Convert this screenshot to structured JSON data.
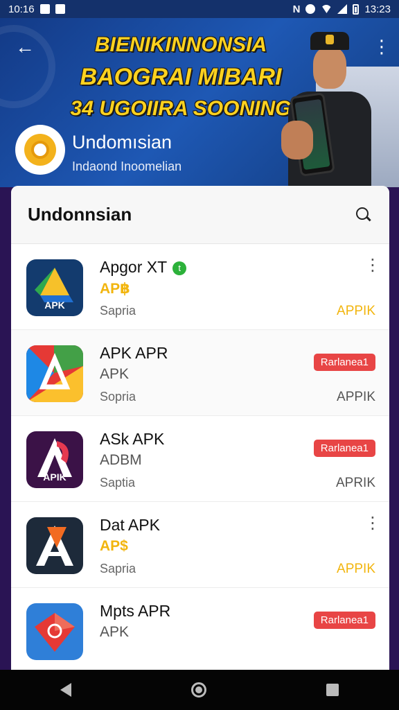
{
  "status_bar": {
    "time": "10:16",
    "clock_right": "13:23"
  },
  "banner": {
    "headline_line1": "BIENIKINNONSIA",
    "headline_line2": "BAOGRAI MIBARI",
    "headline_line3": "34 UGOIIRA SOONING",
    "app_name": "Undomısian",
    "app_subtitle": "Indaond Inoomelian"
  },
  "card": {
    "title": "Undonnsian",
    "apps": [
      {
        "name": "Apgor XT",
        "verified_mark": "t",
        "sub": "AP฿",
        "meta": "Sapria",
        "right": "APPIK"
      },
      {
        "name": "APK APR",
        "sub": "APK",
        "meta": "Sopria",
        "right": "APPIK",
        "badge": "Rarlanea1"
      },
      {
        "name": "ASk APK",
        "sub": "ADBM",
        "meta": "Saptia",
        "right": "APRIK",
        "badge": "Rarlanea1"
      },
      {
        "name": "Dat APK",
        "sub": "AP$",
        "meta": "Sapria",
        "right": "APPIK"
      },
      {
        "name": "Mpts APR",
        "sub": "APK",
        "badge": "Rarlanea1"
      }
    ],
    "icon_labels": {
      "app0": "APK",
      "app2": "APIK"
    }
  },
  "colors": {
    "banner_bg": "#1a4a9e",
    "accent_gold": "#f2b50e",
    "badge_red": "#e84545",
    "page_bg": "#2a1454"
  }
}
